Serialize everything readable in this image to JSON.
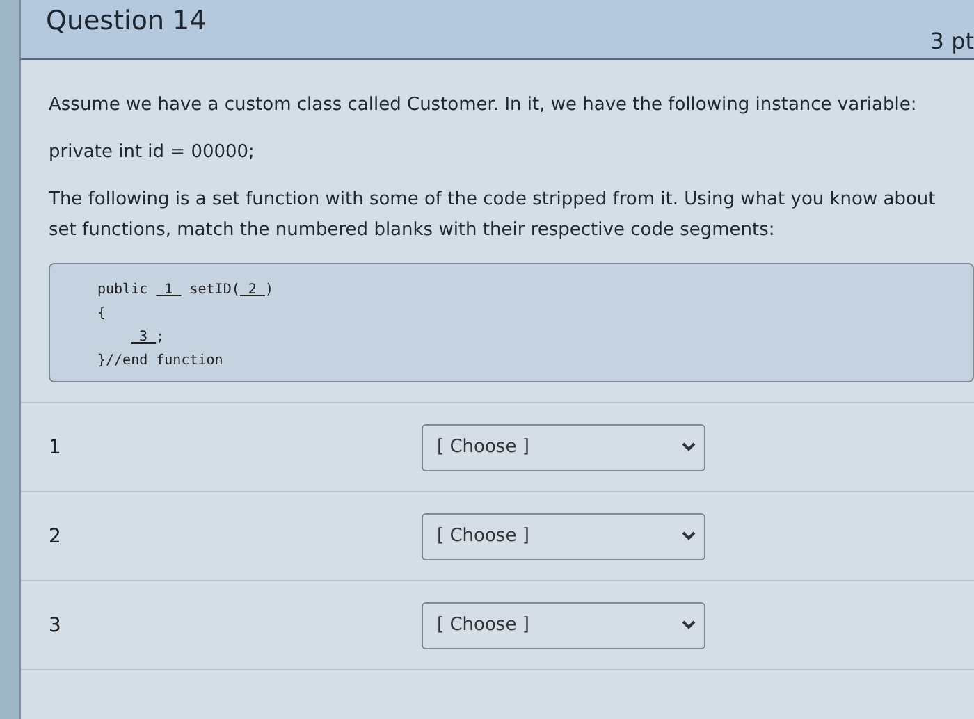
{
  "question": {
    "title": "Question 14",
    "points": "3 pt"
  },
  "paragraphs": [
    "Assume we have a custom class called Customer. In it, we have the following instance variable:",
    "private int id = 00000;",
    "The following is a set function with some of the code stripped from it. Using what you know about set functions, match the numbered blanks with their respective code segments:"
  ],
  "code_lines": [
    {
      "indented": false,
      "segments": [
        {
          "kind": "text",
          "text": "public "
        },
        {
          "kind": "blank",
          "text": "1"
        },
        {
          "kind": "text",
          "text": " setID("
        },
        {
          "kind": "blank",
          "text": "2"
        },
        {
          "kind": "text",
          "text": ")"
        }
      ]
    },
    {
      "indented": false,
      "segments": [
        {
          "kind": "text",
          "text": "{"
        }
      ]
    },
    {
      "indented": true,
      "segments": [
        {
          "kind": "blank",
          "text": "3"
        },
        {
          "kind": "text",
          "text": ";"
        }
      ]
    },
    {
      "indented": false,
      "segments": [
        {
          "kind": "text",
          "text": "}//end function"
        }
      ]
    }
  ],
  "matches": [
    {
      "number": "1",
      "answer": "[ Choose ]"
    },
    {
      "number": "2",
      "answer": "[ Choose ]"
    },
    {
      "number": "3",
      "answer": "[ Choose ]"
    }
  ]
}
